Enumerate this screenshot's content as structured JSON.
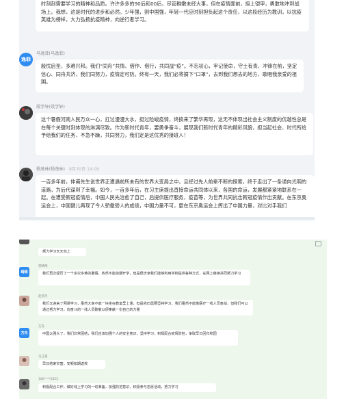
{
  "chat_top": {
    "messages": [
      {
        "user": "",
        "time": "",
        "avatar_text": "",
        "text": "时刻刻需要学习的精神和品质。许许多多的90后和00后，尽管稚嫩未经大事，但在疫情面前，挺上铠甲，勇敢地冲到战场上。我想，这是时代的进步和必然。少年强，则中国强，年轻一代应时刻担负起这个责任，以这段经历为教训，以抗疫英雄为榜样，大力弘扬抗疫精神，向逆行者学习。"
      },
      {
        "user": "马逸菲(马逸菲)",
        "time": "",
        "avatar_text": "逸菲",
        "text": "殷忧启圣，多难兴邦。我们“同舟”共情、借作、借行，共同战“疫”。不忘初心，牢记使命，守土有责、冲锋在前，坚定信心、同舟共济，我们同努力，疫情定可防。终有一天，我们必将摘下“口罩”，去到我们想去的地方，歌唱我亲爱的祖国。"
      },
      {
        "user": "段学轩(段学轩)",
        "time": "",
        "avatar_text": "",
        "text": "这个暑假河南人民万众一心，扛过漫漫大水，挺过险峻疫情，终换来了繁华再现，这无不体现出社会主义制度的优越性总是在每个关键时刻体现的淋漓尽致。作为新时代青年，要勇争奋斗，展现我们新时代青年的精彩风貌，担当起社会、时代所给予给我们的任务，不急不躁，共同努力，我们定是这优秀的接班人！"
      },
      {
        "user": "杨茂林(杨茂林)",
        "time": "8月30日 14:09",
        "avatar_text": "",
        "text": "一百多年前，仲甫先生说世界正遭遇前所未有的世界大变局之中，且经过先人前辈不断的探索，终于走出了一条通向光明的道路，为后代谋到了幸福。如今，一百多年后，在习主席提出直接命运共同体以来，各国的命运，发展都紧紧地联系在一起。在遭受新冠疫情后，中国人民先治愈了自己，后提供医疗服务，疫苗等，为世界共同抗击新冠疫情作出贡献。在东京奥运会上，中国健儿再现了今人骄傲骄人的成绩，中国力量不可，更在东京奥运会上挥出了中国力量，对比对手我们"
      }
    ]
  },
  "chat_bottom": {
    "messages": [
      {
        "user": "",
        "time": "",
        "avatar_text": "",
        "text": "努力学习天天向上"
      },
      {
        "user": "李晴晴",
        "time": "",
        "avatar_text": "晴晴",
        "text": "我们再次经历了一个多灾多难的暑假，依然不能如期开学，但是很庆幸我们能够利用学校提供各种方式，在网上继续共同努力学习"
      },
      {
        "user": "赵英丹",
        "time": "",
        "avatar_text": "",
        "text": "我们又迎来了网课学习，虽然大家不能一块坐在教室里上课，但是依旧需要坚持学习，我们虽然不能像医疗一线人员奋战，但我们可以通过努力学习，向奋斗的一线人员致敬以便奉献一份自己的力量"
      },
      {
        "user": "方舟",
        "time": "",
        "avatar_text": "方舟",
        "text": "中国太强大了，我们非常团结，我们应该加强个人的安全意识，坚持学习，积极配合疫情防控，争取早日回归校园"
      },
      {
        "user": "马江豪",
        "time": "",
        "avatar_text": "",
        "text": "早日结束灾害，安顿如期返校"
      },
      {
        "user": "180****5853",
        "time": "",
        "avatar_text": "",
        "text": "积极配合工作，做好线上学习的一切准备，加强防范意识，积极参与志愿活动，努力学习"
      }
    ]
  },
  "colors": {
    "top_bg": "#f1f3f6",
    "bottom_bg": "#edf7ec",
    "blue_avatar": "#2f8cf0",
    "green_avatar": "#2a9d5c"
  }
}
